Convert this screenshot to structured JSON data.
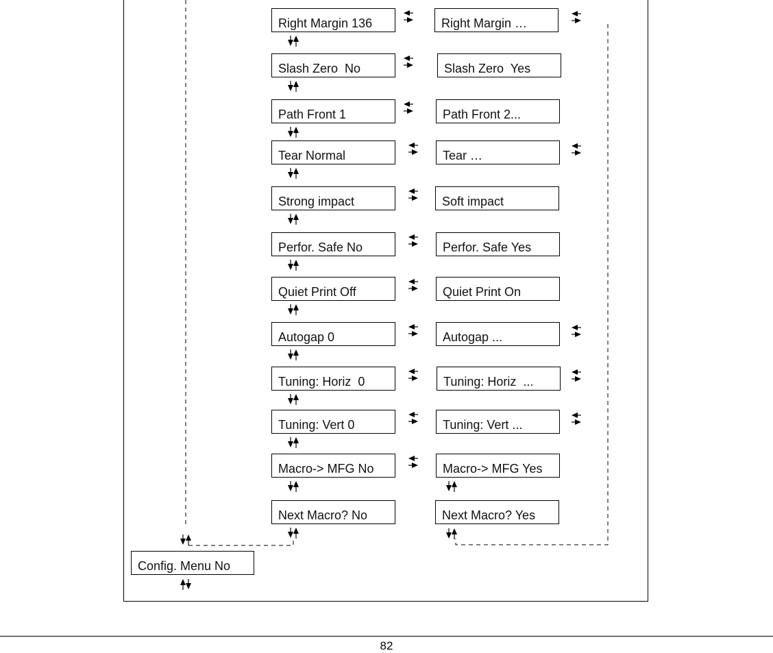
{
  "menu": {
    "left_column": [
      "Right Margin 136",
      "Slash Zero  No",
      "Path Front 1",
      "Tear Normal",
      "Strong impact",
      "Perfor. Safe No",
      "Quiet Print Off",
      "Autogap 0",
      "Tuning: Horiz  0",
      "Tuning: Vert 0",
      "Macro-> MFG No",
      "Next Macro? No"
    ],
    "right_column": [
      "Right Margin …",
      "Slash Zero  Yes",
      "Path Front 2...",
      "Tear …",
      "Soft impact",
      "Perfor. Safe Yes",
      "Quiet Print On",
      "Autogap ...",
      "Tuning: Horiz  ...",
      "Tuning: Vert ...",
      "Macro-> MFG Yes",
      "Next Macro? Yes"
    ],
    "root": "Config. Menu No"
  },
  "footer": {
    "page_number": "82"
  },
  "icons": {
    "horizontal": "left-right-arrows-icon",
    "vertical": "up-down-arrows-icon"
  }
}
